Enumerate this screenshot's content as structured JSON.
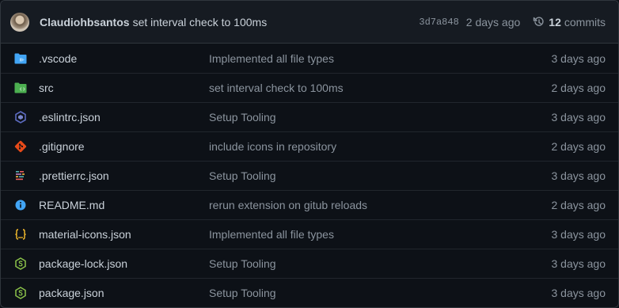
{
  "header": {
    "author": "Claudiohbsantos",
    "message": "set interval check to 100ms",
    "sha": "3d7a848",
    "time": "2 days ago",
    "commit_count": "12",
    "commits_label": "commits"
  },
  "files": [
    {
      "name": ".vscode",
      "message": "Implemented all file types",
      "time": "3 days ago",
      "icon": "folder-vscode-icon"
    },
    {
      "name": "src",
      "message": "set interval check to 100ms",
      "time": "2 days ago",
      "icon": "folder-src-icon"
    },
    {
      "name": ".eslintrc.json",
      "message": "Setup Tooling",
      "time": "3 days ago",
      "icon": "eslint-icon"
    },
    {
      "name": ".gitignore",
      "message": "include icons in repository",
      "time": "2 days ago",
      "icon": "git-icon"
    },
    {
      "name": ".prettierrc.json",
      "message": "Setup Tooling",
      "time": "3 days ago",
      "icon": "prettier-icon"
    },
    {
      "name": "README.md",
      "message": "rerun extension on gitub reloads",
      "time": "2 days ago",
      "icon": "info-icon"
    },
    {
      "name": "material-icons.json",
      "message": "Implemented all file types",
      "time": "3 days ago",
      "icon": "json-icon"
    },
    {
      "name": "package-lock.json",
      "message": "Setup Tooling",
      "time": "3 days ago",
      "icon": "nodejs-icon"
    },
    {
      "name": "package.json",
      "message": "Setup Tooling",
      "time": "3 days ago",
      "icon": "nodejs-icon"
    }
  ],
  "colors": {
    "background": "#0d1117",
    "header_bg": "#161b22",
    "border": "#30363d",
    "text": "#c9d1d9",
    "muted": "#8b949e",
    "folder_blue": "#42a5f5",
    "folder_green": "#4caf50",
    "eslint": "#5c6bc0",
    "git": "#e64a19",
    "info": "#42a5f5",
    "json": "#fbc02d",
    "node": "#8bc34a"
  }
}
